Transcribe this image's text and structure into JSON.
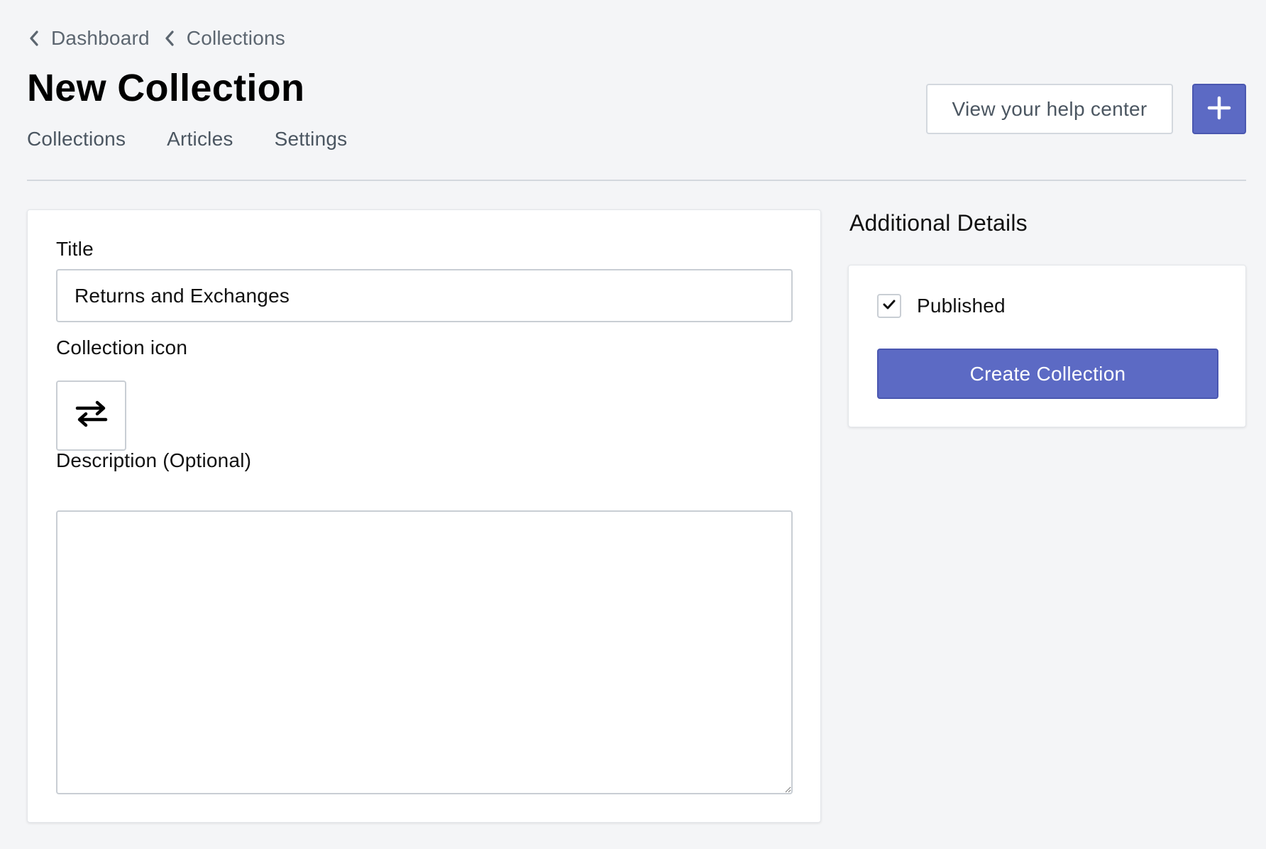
{
  "colors": {
    "page_background": "#f4f5f7",
    "primary": "#5c6ac4",
    "border": "#c9ced4",
    "muted_text": "#5c6670"
  },
  "breadcrumbs": [
    {
      "label": "Dashboard",
      "icon": "chevron-left-icon"
    },
    {
      "label": "Collections",
      "icon": "chevron-left-icon"
    }
  ],
  "header": {
    "title": "New Collection",
    "help_button_label": "View your help center",
    "add_button_icon": "plus-icon"
  },
  "tabs": [
    {
      "label": "Collections"
    },
    {
      "label": "Articles"
    },
    {
      "label": "Settings"
    }
  ],
  "form": {
    "title_label": "Title",
    "title_value": "Returns and Exchanges",
    "icon_label": "Collection icon",
    "icon_value": "arrows-exchange-icon",
    "description_label": "Description (Optional)",
    "description_value": ""
  },
  "sidebar": {
    "heading": "Additional Details",
    "published_label": "Published",
    "published_checked": true,
    "create_button_label": "Create Collection"
  }
}
